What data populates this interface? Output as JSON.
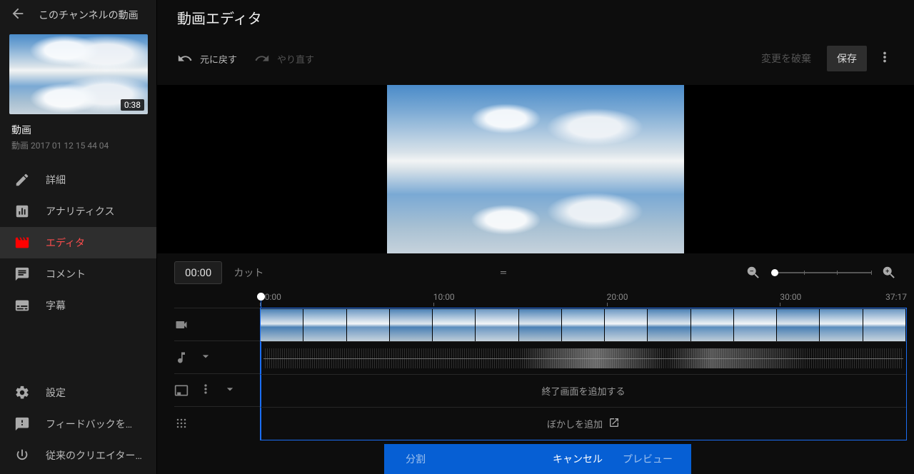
{
  "sidebar": {
    "back_label": "このチャンネルの動画",
    "thumbnail_duration": "0:38",
    "video_title": "動画",
    "video_subtitle": "動画 2017 01 12 15 44 04",
    "nav": [
      {
        "icon": "pencil-icon",
        "label": "詳細"
      },
      {
        "icon": "analytics-icon",
        "label": "アナリティクス"
      },
      {
        "icon": "editor-icon",
        "label": "エディタ",
        "active": true
      },
      {
        "icon": "comments-icon",
        "label": "コメント"
      },
      {
        "icon": "subtitles-icon",
        "label": "字幕"
      }
    ],
    "footer": [
      {
        "icon": "gear-icon",
        "label": "設定"
      },
      {
        "icon": "feedback-icon",
        "label": "フィードバックを送信"
      },
      {
        "icon": "exit-icon",
        "label": "従来のクリエイター …"
      }
    ]
  },
  "header": {
    "title": "動画エディタ",
    "undo": "元に戻す",
    "redo": "やり直す",
    "discard": "変更を破棄",
    "save": "保存"
  },
  "timeline": {
    "timecode": "00:00",
    "cut": "カット",
    "ruler": [
      "00:00",
      "10:00",
      "20:00",
      "30:00"
    ],
    "end_time": "37:17",
    "end_screen": "終了画面を追加する",
    "blur": "ぼかしを追加",
    "frame_count": 15
  },
  "bottombar": {
    "split": "分割",
    "cancel": "キャンセル",
    "preview": "プレビュー"
  }
}
